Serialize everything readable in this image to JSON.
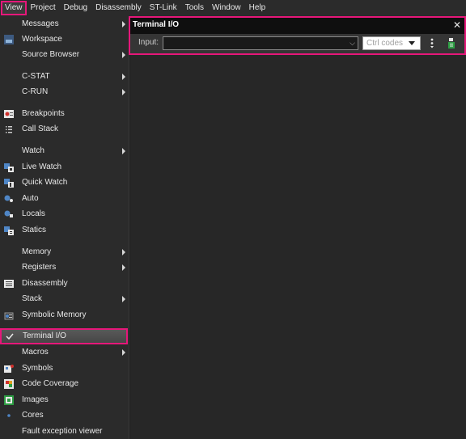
{
  "menubar": {
    "items": [
      {
        "label": "View"
      },
      {
        "label": "Project"
      },
      {
        "label": "Debug"
      },
      {
        "label": "Disassembly"
      },
      {
        "label": "ST-Link"
      },
      {
        "label": "Tools"
      },
      {
        "label": "Window"
      },
      {
        "label": "Help"
      }
    ]
  },
  "view_menu": {
    "items": [
      {
        "label": "Messages",
        "icon": "none",
        "submenu": true
      },
      {
        "label": "Workspace",
        "icon": "workspace-icon",
        "submenu": false
      },
      {
        "label": "Source Browser",
        "icon": "none",
        "submenu": true
      },
      {
        "label": "C-STAT",
        "icon": "none",
        "submenu": true
      },
      {
        "label": "C-RUN",
        "icon": "none",
        "submenu": true
      },
      {
        "label": "Breakpoints",
        "icon": "breakpoints-icon",
        "submenu": false
      },
      {
        "label": "Call Stack",
        "icon": "call-stack-icon",
        "submenu": false
      },
      {
        "label": "Watch",
        "icon": "none",
        "submenu": true
      },
      {
        "label": "Live Watch",
        "icon": "live-watch-icon",
        "submenu": false
      },
      {
        "label": "Quick Watch",
        "icon": "quick-watch-icon",
        "submenu": false
      },
      {
        "label": "Auto",
        "icon": "auto-icon",
        "submenu": false
      },
      {
        "label": "Locals",
        "icon": "locals-icon",
        "submenu": false
      },
      {
        "label": "Statics",
        "icon": "statics-icon",
        "submenu": false
      },
      {
        "label": "Memory",
        "icon": "none",
        "submenu": true
      },
      {
        "label": "Registers",
        "icon": "none",
        "submenu": true
      },
      {
        "label": "Disassembly",
        "icon": "disassembly-icon",
        "submenu": false
      },
      {
        "label": "Stack",
        "icon": "none",
        "submenu": true
      },
      {
        "label": "Symbolic Memory",
        "icon": "symbolic-memory-icon",
        "submenu": false
      },
      {
        "label": "Terminal I/O",
        "icon": "checkmark-icon",
        "submenu": false,
        "checked": true
      },
      {
        "label": "Macros",
        "icon": "none",
        "submenu": true
      },
      {
        "label": "Symbols",
        "icon": "symbols-icon",
        "submenu": false
      },
      {
        "label": "Code Coverage",
        "icon": "code-coverage-icon",
        "submenu": false
      },
      {
        "label": "Images",
        "icon": "images-icon",
        "submenu": false
      },
      {
        "label": "Cores",
        "icon": "cores-icon",
        "submenu": false
      },
      {
        "label": "Fault exception viewer",
        "icon": "none",
        "submenu": false
      }
    ]
  },
  "terminal": {
    "title": "Terminal I/O",
    "close_glyph": "✕",
    "input_label": "Input:",
    "input_value": "",
    "ctrl_codes_label": "Ctrl codes"
  },
  "colors": {
    "highlight": "#e6177a",
    "menu_bg": "#2b2b2b",
    "panel_bg": "#272727"
  }
}
